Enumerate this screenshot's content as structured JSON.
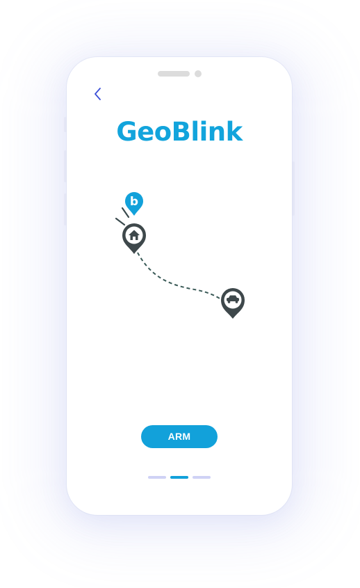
{
  "app": {
    "title": "GeoBlink",
    "brand_color": "#12a4dc"
  },
  "nav": {
    "back_icon": "chevron-left-icon"
  },
  "map": {
    "badge_letter": "b",
    "home_icon": "home-icon",
    "car_icon": "car-icon",
    "route_style": "dashed"
  },
  "actions": {
    "arm_label": "ARM"
  },
  "pagination": {
    "total": 3,
    "active_index": 1
  }
}
